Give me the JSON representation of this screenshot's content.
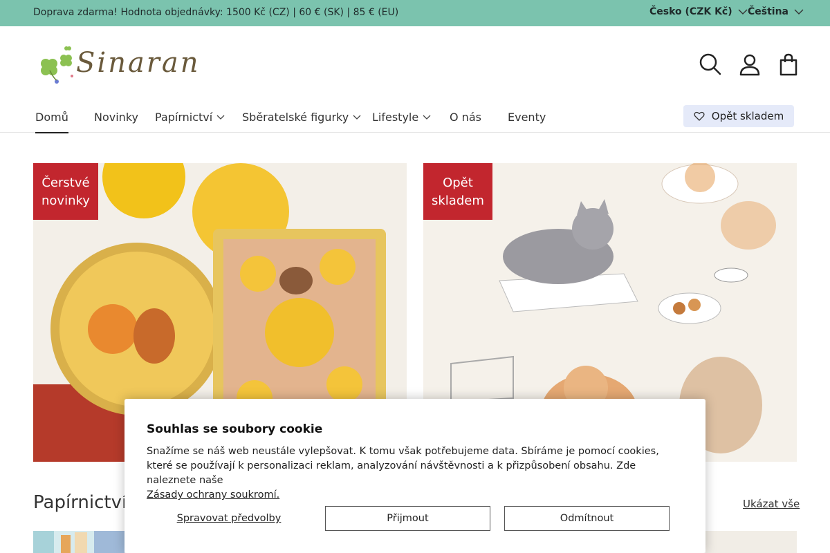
{
  "topbar": {
    "promo": "Doprava zdarma! Hodnota objednávky: 1500 Kč (CZ) | 60 € (SK) | 85 € (EU)",
    "country": "Česko (CZK Kč)",
    "language": "Čeština"
  },
  "header": {
    "logo_text": "Sinaran",
    "icons": [
      "search-icon",
      "account-icon",
      "cart-icon"
    ]
  },
  "nav": {
    "items": [
      {
        "label": "Domů",
        "active": true
      },
      {
        "label": "Novinky"
      },
      {
        "label": "Papírnictví",
        "dropdown": true
      },
      {
        "label": "Sběratelské figurky",
        "dropdown": true
      },
      {
        "label": "Lifestyle",
        "dropdown": true
      },
      {
        "label": "O nás"
      },
      {
        "label": "Eventy"
      }
    ],
    "restock_label": "Opět skladem"
  },
  "promos": [
    {
      "badge_line1": "Čerstvé",
      "badge_line2": "novinky"
    },
    {
      "badge_line1": "Opět",
      "badge_line2": "skladem"
    }
  ],
  "section": {
    "title": "Papírnictví",
    "view_all": "Ukázat vše"
  },
  "cookie": {
    "title": "Souhlas se soubory cookie",
    "text": "Snažíme se náš web neustále vylepšovat. K tomu však potřebujeme data. Sbíráme je pomocí cookies, které se používají k personalizaci reklam, analyzování návštěvnosti a k přizpůsobení obsahu. Zde naleznete naše",
    "link": "Zásady ochrany soukromí.",
    "manage": "Spravovat předvolby",
    "accept": "Přijmout",
    "decline": "Odmítnout"
  },
  "colors": {
    "topbar": "#7bc3ae",
    "badge": "#c2262e",
    "restock_bg": "#e5eaf9"
  }
}
